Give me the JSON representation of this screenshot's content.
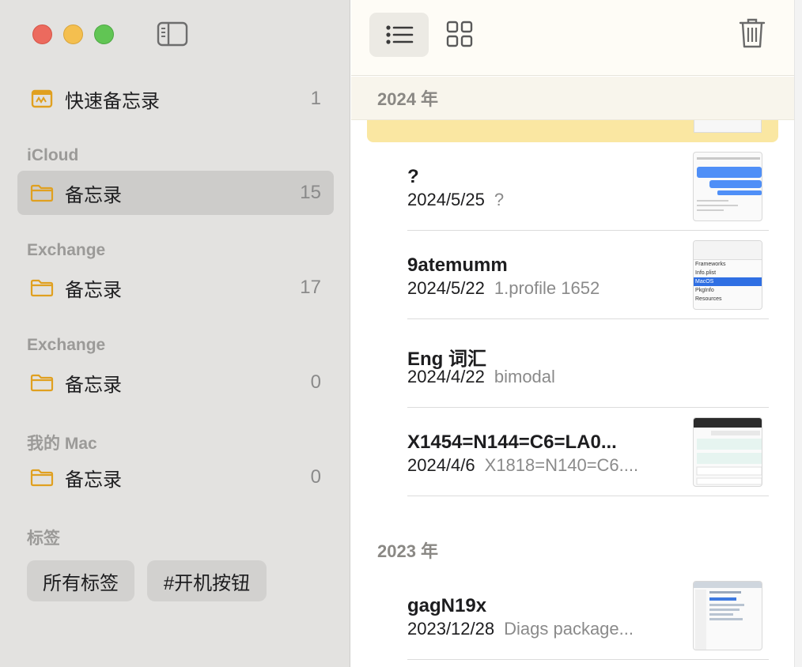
{
  "sidebar": {
    "quick_notes": {
      "label": "快速备忘录",
      "count": "1"
    },
    "sections": [
      {
        "header": "iCloud",
        "folder": {
          "label": "备忘录",
          "count": "15"
        }
      },
      {
        "header": "Exchange",
        "folder": {
          "label": "备忘录",
          "count": "17"
        }
      },
      {
        "header": "Exchange",
        "folder": {
          "label": "备忘录",
          "count": "0"
        }
      },
      {
        "header": "我的 Mac",
        "folder": {
          "label": "备忘录",
          "count": "0"
        }
      }
    ],
    "tags": {
      "header": "标签",
      "items": [
        "所有标签",
        "#开机按钮"
      ]
    }
  },
  "list": {
    "groups": [
      {
        "year": "2024 年",
        "notes": [
          {
            "title": "?",
            "date": "2024/5/25",
            "preview": "?"
          },
          {
            "title": "9atemumm",
            "date": "2024/5/22",
            "preview": "1.profile 1652"
          },
          {
            "title": "Eng 词汇",
            "date": "2024/4/22",
            "preview": "bimodal"
          },
          {
            "title": "X1454=N144=C6=LA0...",
            "date": "2024/4/6",
            "preview": "X1818=N140=C6...."
          }
        ]
      },
      {
        "year": "2023 年",
        "notes": [
          {
            "title": "gagN19x",
            "date": "2023/12/28",
            "preview": "Diags package..."
          }
        ]
      }
    ],
    "thumb_9atemumm": {
      "items": [
        "Frameworks",
        "Info.plist",
        "MacOS",
        "PkgInfo",
        "Resources"
      ]
    }
  },
  "colors": {
    "accent_folder": "#e0a020",
    "highlight": "#fae7a2",
    "sidebar_bg": "#e3e2e0"
  }
}
